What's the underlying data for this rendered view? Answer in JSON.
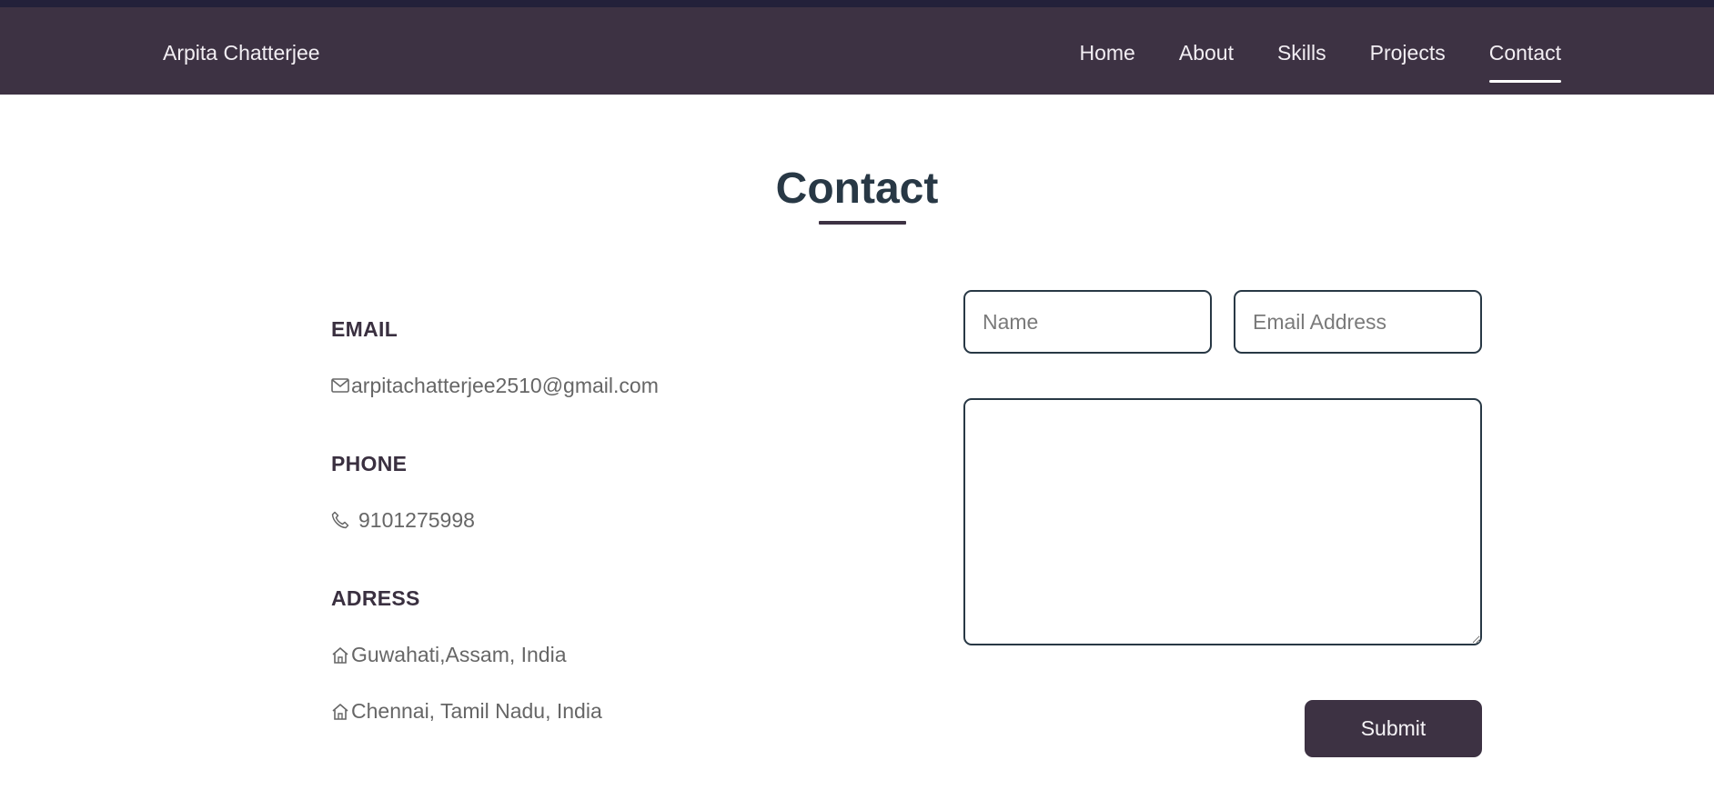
{
  "header": {
    "brand": "Arpita Chatterjee",
    "nav": [
      {
        "label": "Home"
      },
      {
        "label": "About"
      },
      {
        "label": "Skills"
      },
      {
        "label": "Projects"
      },
      {
        "label": "Contact",
        "active": true
      }
    ]
  },
  "section": {
    "title": "Contact"
  },
  "info": {
    "email": {
      "heading": "EMAIL",
      "value": "arpitachatterjee2510@gmail.com",
      "icon": "mail-icon"
    },
    "phone": {
      "heading": "PHONE",
      "value": "9101275998",
      "icon": "phone-icon"
    },
    "address": {
      "heading": "ADRESS",
      "lines": [
        {
          "value": "Guwahati,Assam, India",
          "icon": "home-icon"
        },
        {
          "value": "Chennai, Tamil Nadu, India",
          "icon": "home-icon"
        }
      ]
    }
  },
  "form": {
    "name_placeholder": "Name",
    "email_placeholder": "Email Address",
    "message_placeholder": "",
    "submit_label": "Submit"
  },
  "colors": {
    "navbar": "#3d3243",
    "title": "#283845",
    "button": "#3d3243",
    "field_border": "#283845"
  }
}
